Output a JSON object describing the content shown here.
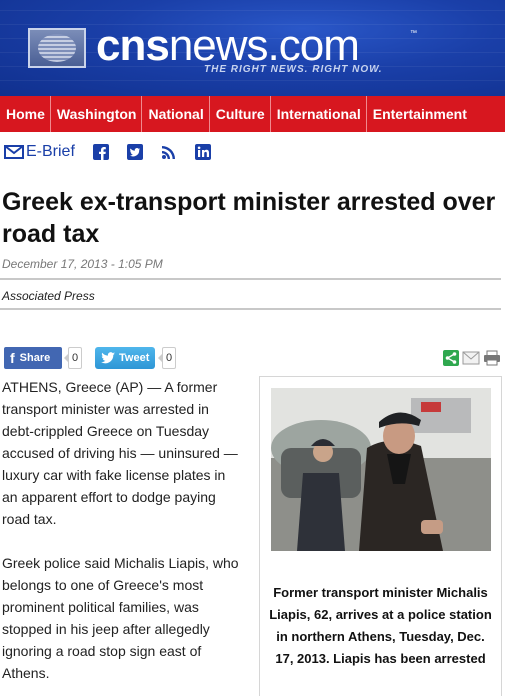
{
  "header": {
    "brand_bold": "cns",
    "brand_light": "news.com",
    "trademark": "™",
    "tagline": "THE RIGHT NEWS. RIGHT NOW."
  },
  "nav": {
    "items": [
      "Home",
      "Washington",
      "National",
      "Culture",
      "International",
      "Entertainment"
    ]
  },
  "social": {
    "ebrief_label": "E-Brief",
    "icons": [
      "facebook-icon",
      "twitter-icon",
      "rss-icon",
      "linkedin-icon"
    ]
  },
  "article": {
    "title": "Greek ex-transport minister arrested over road tax",
    "date": "December 17, 2013 - 1:05 PM",
    "byline": "Associated Press",
    "paragraphs": [
      "ATHENS, Greece (AP) — A former transport minister was arrested in debt-crippled Greece on Tuesday accused of driving his — uninsured — luxury car with fake license plates in an apparent effort to dodge paying road tax.",
      "Greek police said Michalis Liapis, who belongs to one of Greece's most prominent political families, was stopped in his jeep after allegedly ignoring a road stop sign east of Athens."
    ],
    "caption": "Former transport minister Michalis Liapis, 62, arrives at a police station in northern Athens, Tuesday, Dec. 17, 2013. Liapis has been arrested"
  },
  "share": {
    "facebook_label": "Share",
    "facebook_count": "0",
    "tweet_label": "Tweet",
    "tweet_count": "0",
    "tools": [
      "share-icon",
      "email-icon",
      "print-icon"
    ]
  },
  "colors": {
    "banner_blue": "#1a3fa8",
    "nav_red": "#d7171f",
    "facebook_blue": "#4267b2",
    "twitter_blue": "#2e96d6",
    "share_green": "#2fa84f"
  }
}
